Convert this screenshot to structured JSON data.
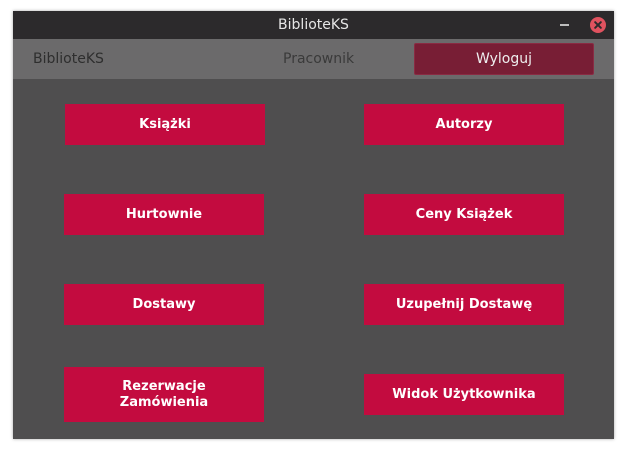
{
  "window": {
    "title": "BiblioteKS"
  },
  "topbar": {
    "brand": "BiblioteKS",
    "role": "Pracownik",
    "logout_label": "Wyloguj"
  },
  "buttons": {
    "books": "Książki",
    "authors": "Autorzy",
    "wholesalers": "Hurtownie",
    "book_prices": "Ceny Książek",
    "deliveries": "Dostawy",
    "fill_delivery": "Uzupełnij Dostawę",
    "reservations_line1": "Rezerwacje",
    "reservations_line2": "Zamówienia",
    "user_view": "Widok Użytkownika"
  },
  "colors": {
    "accent": "#c30b3f",
    "logout": "#781e35",
    "background": "#4f4e4f",
    "topbar": "#6b6a6b",
    "titlebar": "#2c2a2c"
  }
}
